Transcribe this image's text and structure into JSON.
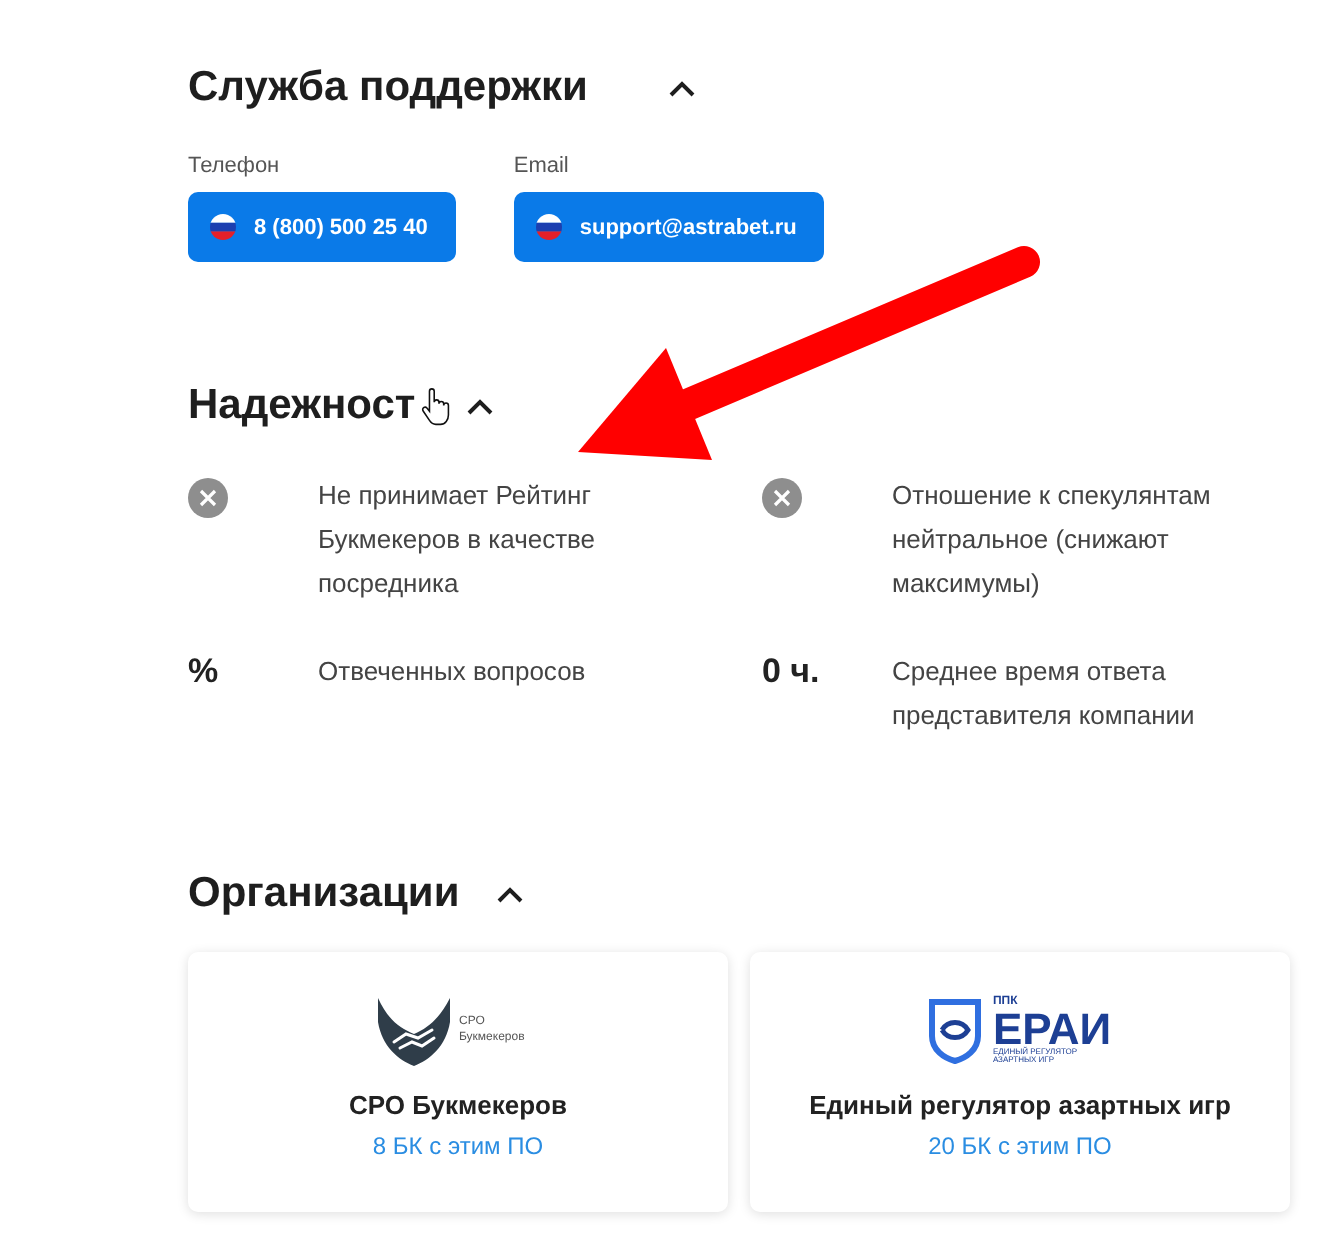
{
  "sections": [
    {
      "kind": "contacts",
      "title": "Служба поддержки",
      "expanded": true,
      "hovered": false,
      "contacts": [
        {
          "label": "Телефон",
          "value": "8 (800) 500 25 40"
        },
        {
          "label": "Email",
          "value": "support@astrabet.ru"
        }
      ]
    },
    {
      "kind": "features",
      "title": "Надежност",
      "expanded": true,
      "hovered": true,
      "items": [
        {
          "kind": "negative",
          "text": "Не принимает Рейтинг Букмекеров в качестве посредника"
        },
        {
          "kind": "negative",
          "text": "Отношение к спекулянтам нейтральное (снижают максимумы)"
        },
        {
          "kind": "stat",
          "value": "%",
          "text": "Отвеченных вопросов"
        },
        {
          "kind": "stat",
          "value": "0 ч.",
          "text": "Среднее время ответа представителя компании"
        }
      ]
    },
    {
      "kind": "organizations",
      "title": "Организации",
      "expanded": true,
      "hovered": false,
      "cards": [
        {
          "logo": {
            "kind": "handshake",
            "caption": "СРО Букмекеров"
          },
          "name": "СРО Букмекеров",
          "link": "8 БК с этим ПО"
        },
        {
          "logo": {
            "kind": "shield",
            "prefix": "ППК",
            "wordmark": "ЕРАИ",
            "tagline": "ЕДИНЫЙ РЕГУЛЯТОР АЗАРТНЫХ ИГР"
          },
          "name": "Единый регулятор азартных игр",
          "link": "20 БК с этим ПО"
        }
      ]
    }
  ]
}
